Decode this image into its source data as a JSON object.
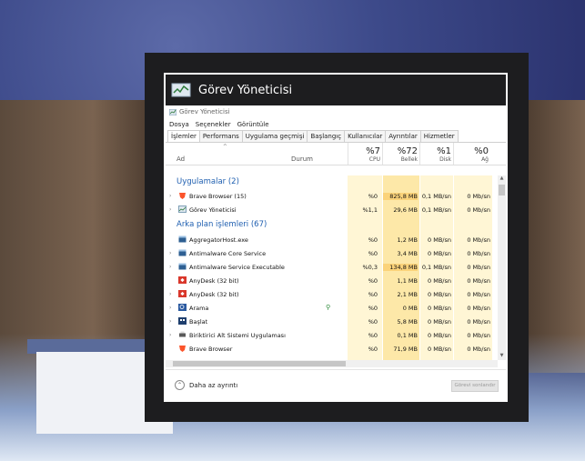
{
  "window": {
    "title": "Görev Yöneticisi",
    "inner_title": "Görev Yöneticisi",
    "menu": [
      "Dosya",
      "Seçenekler",
      "Görüntüle"
    ],
    "tabs": [
      "İşlemler",
      "Performans",
      "Uygulama geçmişi",
      "Başlangıç",
      "Kullanıcılar",
      "Ayrıntılar",
      "Hizmetler"
    ],
    "active_tab": 0
  },
  "columns": {
    "name": "Ad",
    "status": "Durum",
    "cpu_pct": "%7",
    "cpu": "CPU",
    "mem_pct": "%72",
    "mem": "Bellek",
    "disk_pct": "%1",
    "disk": "Disk",
    "net_pct": "%0",
    "net": "Ağ"
  },
  "groups": {
    "apps": "Uygulamalar (2)",
    "background": "Arka plan işlemleri (67)"
  },
  "apps": [
    {
      "name": "Brave Browser (15)",
      "cpu": "%0",
      "mem": "825,8 MB",
      "disk": "0,1 MB/sn",
      "net": "0 Mb/sn",
      "icon": "brave-lion-icon",
      "expand": true
    },
    {
      "name": "Görev Yöneticisi",
      "cpu": "%1,1",
      "mem": "29,6 MB",
      "disk": "0,1 MB/sn",
      "net": "0 Mb/sn",
      "icon": "task-manager-icon",
      "expand": true
    }
  ],
  "background": [
    {
      "name": "AggregatorHost.exe",
      "cpu": "%0",
      "mem": "1,2 MB",
      "disk": "0 MB/sn",
      "net": "0 Mb/sn",
      "icon": "app-window-icon",
      "expand": false
    },
    {
      "name": "Antimalware Core Service",
      "cpu": "%0",
      "mem": "3,4 MB",
      "disk": "0 MB/sn",
      "net": "0 Mb/sn",
      "icon": "app-window-icon",
      "expand": true
    },
    {
      "name": "Antimalware Service Executable",
      "cpu": "%0,3",
      "mem": "134,8 MB",
      "disk": "0,1 MB/sn",
      "net": "0 Mb/sn",
      "icon": "app-window-icon",
      "expand": true
    },
    {
      "name": "AnyDesk (32 bit)",
      "cpu": "%0",
      "mem": "1,1 MB",
      "disk": "0 MB/sn",
      "net": "0 Mb/sn",
      "icon": "anydesk-icon",
      "expand": false
    },
    {
      "name": "AnyDesk (32 bit)",
      "cpu": "%0",
      "mem": "2,1 MB",
      "disk": "0 MB/sn",
      "net": "0 Mb/sn",
      "icon": "anydesk-icon",
      "expand": true
    },
    {
      "name": "Arama",
      "cpu": "%0",
      "mem": "0 MB",
      "disk": "0 MB/sn",
      "net": "0 Mb/sn",
      "icon": "search-app-icon",
      "expand": true,
      "pin": true
    },
    {
      "name": "Başlat",
      "cpu": "%0",
      "mem": "5,8 MB",
      "disk": "0 MB/sn",
      "net": "0 Mb/sn",
      "icon": "start-app-icon",
      "expand": true
    },
    {
      "name": "Biriktirici Alt Sistemi Uygulaması",
      "cpu": "%0",
      "mem": "0,1 MB",
      "disk": "0 MB/sn",
      "net": "0 Mb/sn",
      "icon": "printer-icon",
      "expand": true
    },
    {
      "name": "Brave Browser",
      "cpu": "%0",
      "mem": "71,9 MB",
      "disk": "0 MB/sn",
      "net": "0 Mb/sn",
      "icon": "brave-lion-icon",
      "expand": false
    }
  ],
  "footer": {
    "less_details": "Daha az ayrıntı",
    "end_task": "Görevi sonlandır"
  },
  "colors": {
    "cpu_col": "#fff6d5",
    "mem_col": "#fde8a8",
    "mem_hot": "#fbd37a",
    "group_text": "#1f5fb0"
  }
}
